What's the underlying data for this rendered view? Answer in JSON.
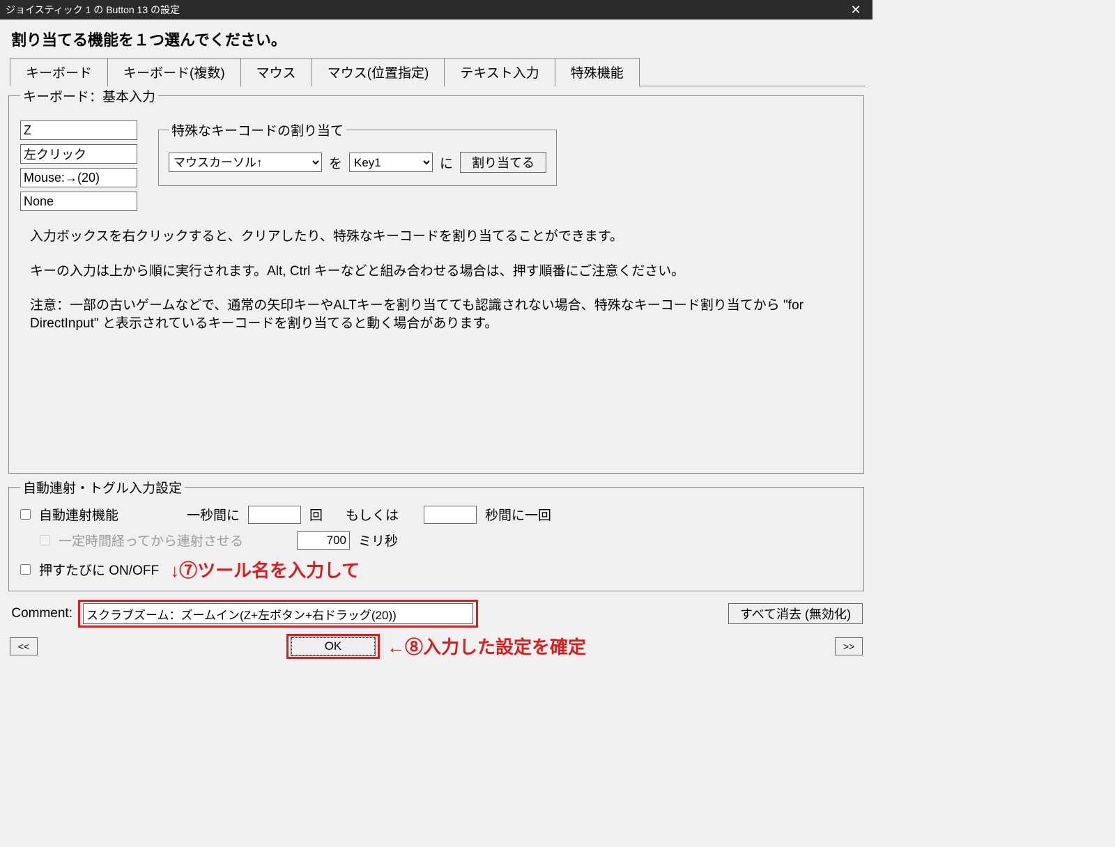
{
  "titlebar": {
    "text": "ジョイスティック 1 の Button 13 の設定"
  },
  "heading": "割り当てる機能を１つ選んでください。",
  "tabs": [
    "キーボード",
    "キーボード(複数)",
    "マウス",
    "マウス(位置指定)",
    "テキスト入力",
    "特殊機能"
  ],
  "group1": {
    "legend": "キーボード：基本入力",
    "inputs": [
      "Z",
      "左クリック",
      "Mouse:→(20)",
      "None"
    ],
    "assign": {
      "legend": "特殊なキーコードの割り当て",
      "src": "マウスカーソル↑",
      "wo": "を",
      "dst": "Key1",
      "ni": "に",
      "btn": "割り当てる"
    },
    "info": [
      "入力ボックスを右クリックすると、クリアしたり、特殊なキーコードを割り当てることができます。",
      "キーの入力は上から順に実行されます。Alt, Ctrl キーなどと組み合わせる場合は、押す順番にご注意ください。",
      "注意：一部の古いゲームなどで、通常の矢印キーやALTキーを割り当てても認識されない場合、特殊なキーコード割り当てから \"for DirectInput\" と表示されているキーコードを割り当てると動く場合があります。"
    ]
  },
  "group2": {
    "legend": "自動連射・トグル入力設定",
    "autofire_label": "自動連射機能",
    "per_sec_pre": "一秒間に",
    "per_sec_val": "",
    "per_sec_unit": "回",
    "or_label": "もしくは",
    "interval_val": "",
    "interval_unit": "秒間に一回",
    "delay_label": "一定時間経ってから連射させる",
    "delay_val": "700",
    "delay_unit": "ミリ秒",
    "toggle_label": "押すたびに ON/OFF"
  },
  "comment": {
    "label": "Comment:",
    "value": "スクラブズーム：ズームイン(Z+左ボタン+右ドラッグ(20))",
    "clear": "すべて消去 (無効化)"
  },
  "ok": "OK",
  "nav_prev": "<<",
  "nav_next": ">>",
  "annotations": {
    "step7": "↓⑦ツール名を入力して",
    "step8": "←⑧入力した設定を確定"
  }
}
